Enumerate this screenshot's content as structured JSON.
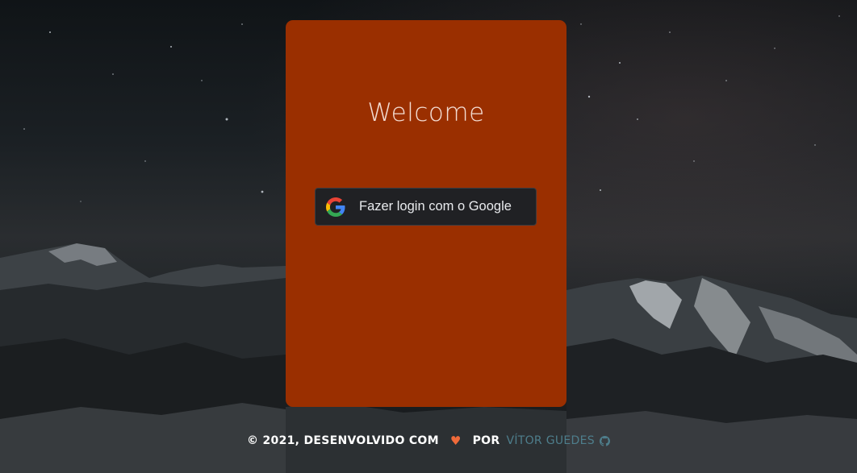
{
  "card": {
    "welcome": "Welcome",
    "google_button_label": "Fazer login com o Google",
    "google_icon": "google-g-icon"
  },
  "footer": {
    "copyright": "© 2021, DESENVOLVIDO COM",
    "heart_icon": "heart-icon",
    "by": "POR",
    "author": "VÍTOR GUEDES",
    "github_icon": "github-icon"
  },
  "colors": {
    "card": "#9a2f00",
    "button_bg": "#202124",
    "heart": "#ef6a3a",
    "author_link": "#4e7e8c"
  }
}
